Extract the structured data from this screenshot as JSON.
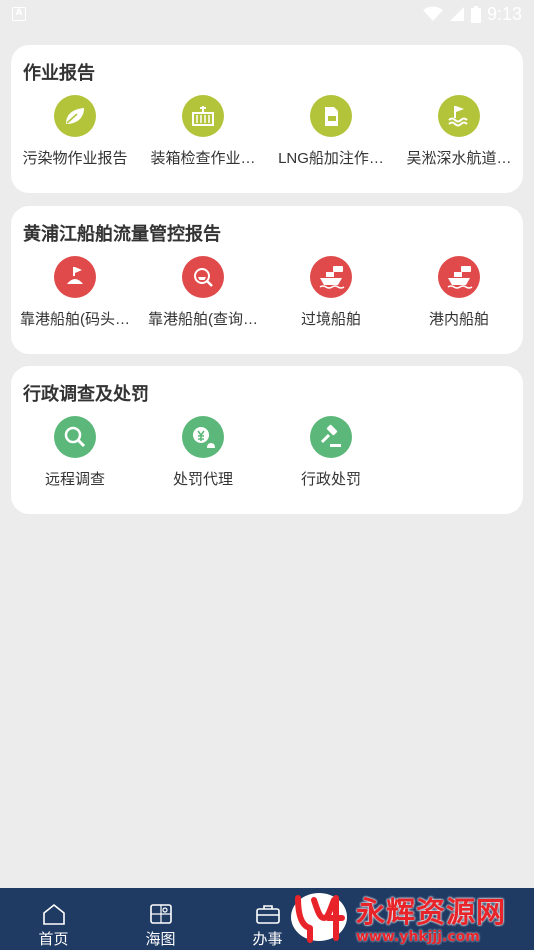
{
  "status_bar": {
    "time": "9:13",
    "notification_glyph": "A",
    "icons": [
      "wifi-icon",
      "signal-icon",
      "battery-icon"
    ]
  },
  "sections": [
    {
      "title": "作业报告",
      "color": "#b4c43a",
      "items": [
        {
          "label": "污染物作业报告",
          "icon": "leaf-icon"
        },
        {
          "label": "装箱检查作业…",
          "icon": "container-icon"
        },
        {
          "label": "LNG船加注作…",
          "icon": "lng-tank-icon"
        },
        {
          "label": "吴淞深水航道…",
          "icon": "waterway-flag-icon"
        }
      ]
    },
    {
      "title": "黄浦江船舶流量管控报告",
      "color": "#e04a4a",
      "items": [
        {
          "label": "靠港船舶(码头…",
          "icon": "buoy-flag-icon"
        },
        {
          "label": "靠港船舶(查询…",
          "icon": "ship-search-icon"
        },
        {
          "label": "过境船舶",
          "icon": "ship-transit-icon"
        },
        {
          "label": "港内船舶",
          "icon": "ship-harbor-icon"
        }
      ]
    },
    {
      "title": "行政调查及处罚",
      "color": "#5cb87a",
      "items": [
        {
          "label": "远程调查",
          "icon": "magnifier-icon"
        },
        {
          "label": "处罚代理",
          "icon": "yen-agent-icon"
        },
        {
          "label": "行政处罚",
          "icon": "gavel-icon"
        }
      ]
    }
  ],
  "tabbar": {
    "tabs": [
      {
        "label": "首页",
        "icon": "home-icon"
      },
      {
        "label": "海图",
        "icon": "chart-map-icon"
      },
      {
        "label": "办事",
        "icon": "briefcase-icon"
      }
    ],
    "background": "#1f3a63"
  },
  "watermark": {
    "text": "永辉资源网",
    "url": "www.yhkjjj.com"
  }
}
